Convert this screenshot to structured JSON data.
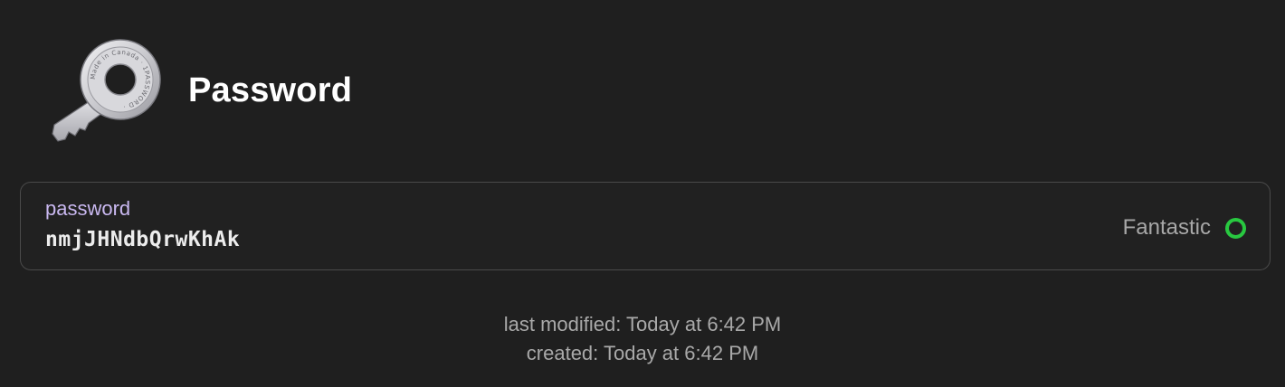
{
  "header": {
    "icon": "key-icon",
    "title": "Password",
    "icon_ring_text": "Made in Canada · 1PASSWORD ·"
  },
  "field": {
    "label": "password",
    "value": "nmjJHNdbQrwKhAk",
    "strength": {
      "label": "Fantastic",
      "indicator_color": "#28c840"
    }
  },
  "meta": {
    "last_modified": "last modified: Today at 6:42 PM",
    "created": "created: Today at 6:42 PM"
  },
  "colors": {
    "background": "#1f1f1f",
    "label_accent": "#c9b8f0",
    "muted_text": "#a9a9a9"
  }
}
